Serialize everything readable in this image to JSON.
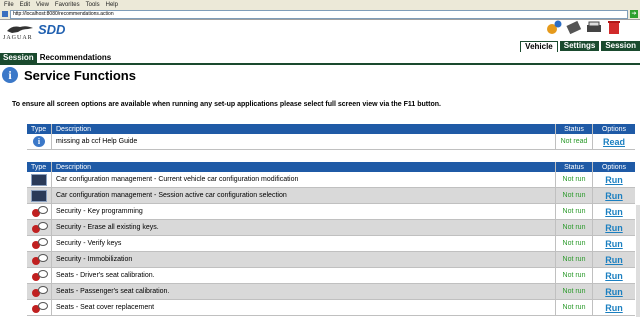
{
  "menu": {
    "items": [
      "File",
      "Edit",
      "View",
      "Favorites",
      "Tools",
      "Help"
    ]
  },
  "address": {
    "url": "http://localhost:8080/recommendations.action"
  },
  "brand": {
    "logo_text": "JAGUAR",
    "app_name": "SDD"
  },
  "header_tabs": [
    {
      "label": "Vehicle",
      "active": true
    },
    {
      "label": "Settings",
      "active": false
    },
    {
      "label": "Session",
      "active": false
    }
  ],
  "nav_tabs": [
    {
      "label": "Session",
      "active": true
    },
    {
      "label": "Recommendations",
      "active": false
    }
  ],
  "page": {
    "title": "Service Functions",
    "note": "To ensure all screen options are available when running any set-up applications please select full screen view via the F11 button."
  },
  "table_headers": {
    "type": "Type",
    "description": "Description",
    "status": "Status",
    "options": "Options"
  },
  "help_rows": [
    {
      "icon": "info-icon",
      "description": "missing ab ccf Help Guide",
      "status": "Not read",
      "option": "Read"
    }
  ],
  "function_rows": [
    {
      "icon": "car-config-icon",
      "description": "Car configuration management - Current vehicle car configuration modification",
      "status": "Not run",
      "option": "Run"
    },
    {
      "icon": "car-config-icon",
      "description": "Car configuration management - Session active car configuration selection",
      "status": "Not run",
      "option": "Run"
    },
    {
      "icon": "security-key-icon",
      "description": "Security - Key programming",
      "status": "Not run",
      "option": "Run"
    },
    {
      "icon": "security-key-icon",
      "description": "Security - Erase all existing keys.",
      "status": "Not run",
      "option": "Run"
    },
    {
      "icon": "security-key-icon",
      "description": "Security - Verify keys",
      "status": "Not run",
      "option": "Run"
    },
    {
      "icon": "security-key-icon",
      "description": "Security - Immobilization",
      "status": "Not run",
      "option": "Run"
    },
    {
      "icon": "security-key-icon",
      "description": "Seats - Driver's seat calibration.",
      "status": "Not run",
      "option": "Run"
    },
    {
      "icon": "security-key-icon",
      "description": "Seats - Passenger's seat calibration.",
      "status": "Not run",
      "option": "Run"
    },
    {
      "icon": "security-key-icon",
      "description": "Seats - Seat cover replacement",
      "status": "Not run",
      "option": "Run"
    }
  ]
}
